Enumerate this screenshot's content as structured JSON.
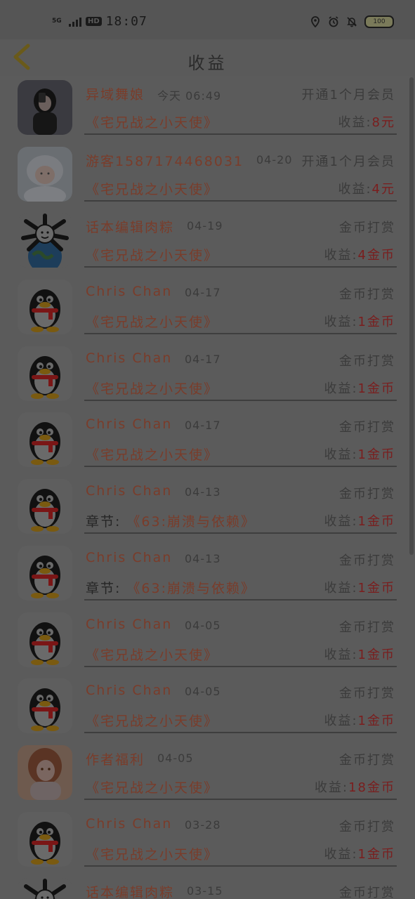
{
  "status_bar": {
    "network": "5G",
    "hd": "HD",
    "time": "18:07",
    "battery": "100"
  },
  "header": {
    "title": "收益"
  },
  "rows": [
    {
      "avatar": "girl-photo",
      "name": "异域舞娘",
      "date": "今天 06:49",
      "type": "开通1个月会员",
      "prefix": "",
      "book": "《宅兄战之小天使》",
      "income_label": "收益:",
      "amount": "8元"
    },
    {
      "avatar": "baby-photo",
      "name": "游客1587174468031",
      "date": "04-20",
      "type": "开通1个月会员",
      "prefix": "",
      "book": "《宅兄战之小天使》",
      "income_label": "收益:",
      "amount": "4元"
    },
    {
      "avatar": "cartoon-globe",
      "name": "话本编辑肉粽",
      "date": "04-19",
      "type": "金币打赏",
      "prefix": "",
      "book": "《宅兄战之小天使》",
      "income_label": "收益:",
      "amount": "4金币"
    },
    {
      "avatar": "penguin",
      "name": "Chris Chan",
      "date": "04-17",
      "type": "金币打赏",
      "prefix": "",
      "book": "《宅兄战之小天使》",
      "income_label": "收益:",
      "amount": "1金币"
    },
    {
      "avatar": "penguin",
      "name": "Chris Chan",
      "date": "04-17",
      "type": "金币打赏",
      "prefix": "",
      "book": "《宅兄战之小天使》",
      "income_label": "收益:",
      "amount": "1金币"
    },
    {
      "avatar": "penguin",
      "name": "Chris Chan",
      "date": "04-17",
      "type": "金币打赏",
      "prefix": "",
      "book": "《宅兄战之小天使》",
      "income_label": "收益:",
      "amount": "1金币"
    },
    {
      "avatar": "penguin",
      "name": "Chris Chan",
      "date": "04-13",
      "type": "金币打赏",
      "prefix": "章节:",
      "book": "《63:崩溃与依赖》",
      "income_label": "收益:",
      "amount": "1金币"
    },
    {
      "avatar": "penguin",
      "name": "Chris Chan",
      "date": "04-13",
      "type": "金币打赏",
      "prefix": "章节:",
      "book": "《63:崩溃与依赖》",
      "income_label": "收益:",
      "amount": "1金币"
    },
    {
      "avatar": "penguin",
      "name": "Chris Chan",
      "date": "04-05",
      "type": "金币打赏",
      "prefix": "",
      "book": "《宅兄战之小天使》",
      "income_label": "收益:",
      "amount": "1金币"
    },
    {
      "avatar": "penguin",
      "name": "Chris Chan",
      "date": "04-05",
      "type": "金币打赏",
      "prefix": "",
      "book": "《宅兄战之小天使》",
      "income_label": "收益:",
      "amount": "1金币"
    },
    {
      "avatar": "anime-girl",
      "name": "作者福利",
      "date": "04-05",
      "type": "金币打赏",
      "prefix": "",
      "book": "《宅兄战之小天使》",
      "income_label": "收益:",
      "amount": "18金币"
    },
    {
      "avatar": "penguin",
      "name": "Chris Chan",
      "date": "03-28",
      "type": "金币打赏",
      "prefix": "",
      "book": "《宅兄战之小天使》",
      "income_label": "收益:",
      "amount": "1金币"
    },
    {
      "avatar": "cartoon-globe",
      "name": "话本编辑肉粽",
      "date": "03-15",
      "type": "金币打赏",
      "prefix": "",
      "book": "",
      "income_label": "",
      "amount": ""
    }
  ]
}
